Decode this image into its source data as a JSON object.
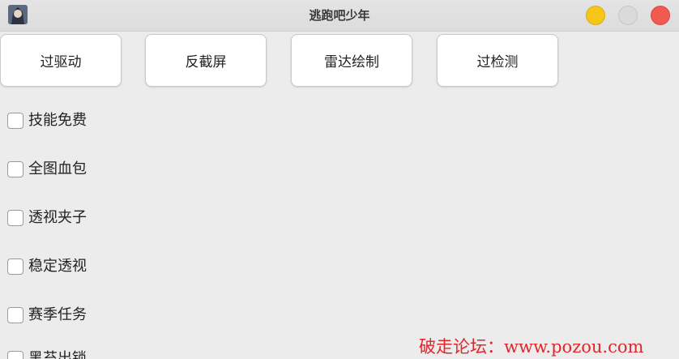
{
  "window": {
    "title": "逃跑吧少年"
  },
  "buttons": [
    {
      "label": "过驱动"
    },
    {
      "label": "反截屏"
    },
    {
      "label": "雷达绘制"
    },
    {
      "label": "过检测"
    }
  ],
  "checkboxes": [
    {
      "label": "技能免费",
      "checked": false
    },
    {
      "label": "全图血包",
      "checked": false
    },
    {
      "label": "透视夹子",
      "checked": false
    },
    {
      "label": "稳定透视",
      "checked": false
    },
    {
      "label": "赛季任务",
      "checked": false
    },
    {
      "label": "黑苔出锁",
      "checked": false
    }
  ],
  "watermark": "破走论坛：www.pozou.com",
  "colors": {
    "minimize": "#f5c518",
    "maximize": "#dadada",
    "close": "#f05a50",
    "watermark": "#e0262a"
  }
}
